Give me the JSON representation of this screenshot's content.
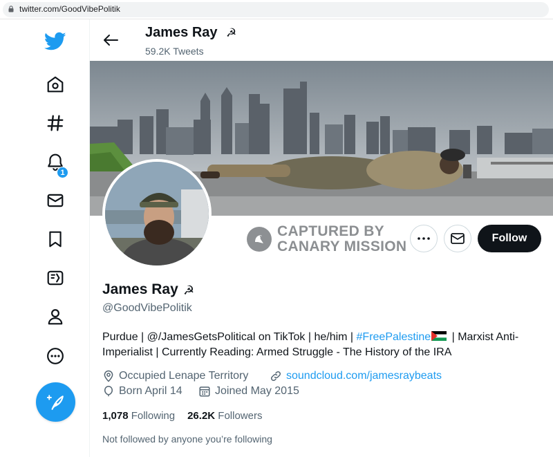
{
  "browser": {
    "url": "twitter.com/GoodVibePolitik"
  },
  "nav": {
    "notification_badge": "1",
    "items": [
      "twitter-logo",
      "home",
      "explore",
      "notifications",
      "messages",
      "bookmarks",
      "lists",
      "profile",
      "more"
    ]
  },
  "header": {
    "name": "James Ray",
    "symbol": "☭",
    "tweet_count": "59.2K Tweets"
  },
  "watermark": {
    "line1": "CAPTURED BY",
    "line2": "CANARY MISSION"
  },
  "actions": {
    "follow_label": "Follow"
  },
  "profile": {
    "name": "James Ray",
    "symbol": "☭",
    "handle": "@GoodVibePolitik",
    "bio_part1": "Purdue | @/JamesGetsPolitical on TikTok | he/him | ",
    "bio_hashtag": "#FreePalestine",
    "bio_part2": " | Marxist Anti-Imperialist | Currently Reading: Armed Struggle - The History of the IRA",
    "location": "Occupied Lenape Territory",
    "website": "soundcloud.com/jamesraybeats",
    "birthday": "Born April 14",
    "joined": "Joined May 2015",
    "following_count": "1,078",
    "following_label": "Following",
    "followers_count": "26.2K",
    "followers_label": "Followers",
    "not_followed": "Not followed by anyone you’re following"
  },
  "colors": {
    "accent": "#1d9bf0",
    "text": "#0f1419",
    "secondary_text": "#536471"
  }
}
